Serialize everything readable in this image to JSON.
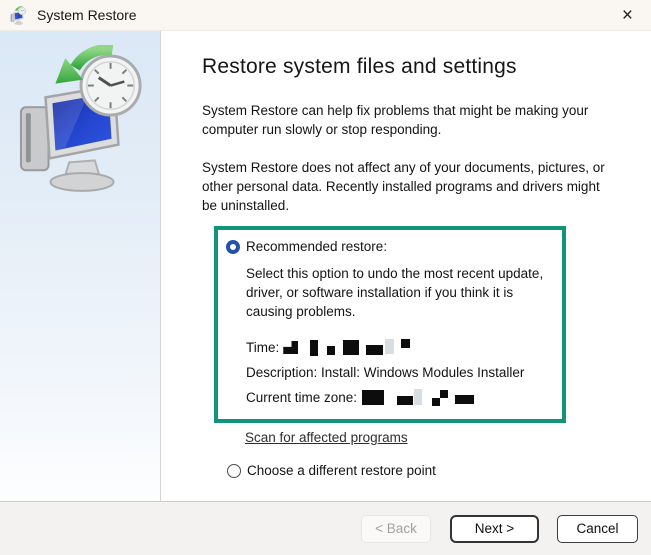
{
  "window": {
    "title": "System Restore",
    "close_icon": "×"
  },
  "main": {
    "heading": "Restore system files and settings",
    "paragraph1": "System Restore can help fix problems that might be making your computer run slowly or stop responding.",
    "paragraph2": "System Restore does not affect any of your documents, pictures, or other personal data. Recently installed programs and drivers might be uninstalled.",
    "recommended": {
      "label": "Recommended restore:",
      "selected": true,
      "description": "Select this option to undo the most recent update, driver, or software installation if you think it is causing problems.",
      "time_label": "Time:",
      "time_value_redacted": true,
      "description_line": "Description: Install: Windows Modules Installer",
      "timezone_label": "Current time zone:",
      "timezone_value_redacted": true
    },
    "scan_link": "Scan for affected programs",
    "choose_different": {
      "label": "Choose a different restore point",
      "selected": false
    }
  },
  "footer": {
    "back_label": "< Back",
    "back_enabled": false,
    "next_label": "Next >",
    "cancel_label": "Cancel"
  },
  "colors": {
    "highlight_border": "#12937b",
    "radio_accent": "#2351a8",
    "titlebar_bg": "#faf7f3",
    "sidebar_top": "#dbe8f6",
    "footer_bg": "#f4f2f0"
  }
}
